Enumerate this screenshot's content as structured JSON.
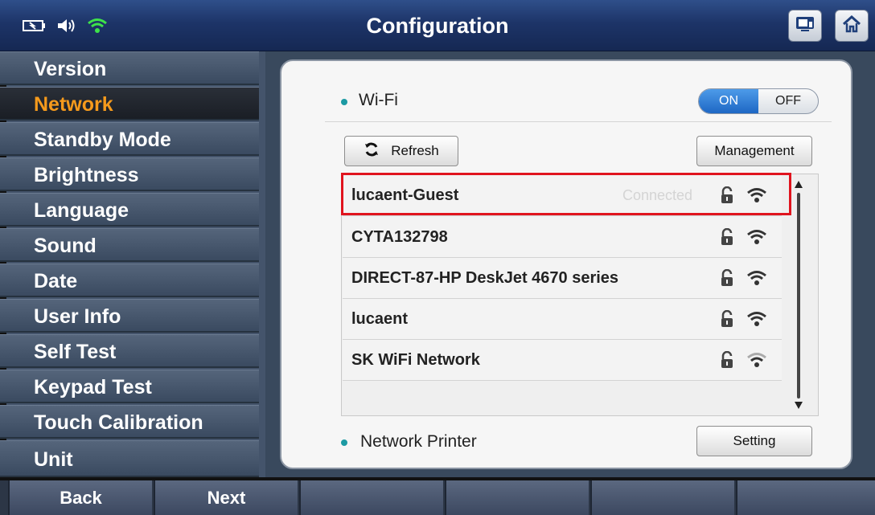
{
  "window": {
    "title": "Configuration"
  },
  "status_icons": [
    "battery-icon",
    "speaker-icon",
    "wifi-icon"
  ],
  "header_buttons": [
    "display-icon",
    "home-icon"
  ],
  "sidebar": {
    "items": [
      {
        "label": "Version"
      },
      {
        "label": "Network",
        "active": true
      },
      {
        "label": "Standby Mode"
      },
      {
        "label": "Brightness"
      },
      {
        "label": "Language"
      },
      {
        "label": "Sound"
      },
      {
        "label": "Date"
      },
      {
        "label": "User Info"
      },
      {
        "label": "Self Test"
      },
      {
        "label": "Keypad Test"
      },
      {
        "label": "Touch Calibration"
      },
      {
        "label": "Unit"
      }
    ]
  },
  "wifi": {
    "label": "Wi-Fi",
    "toggle": {
      "on": "ON",
      "off": "OFF",
      "state": "ON"
    },
    "refresh_label": "Refresh",
    "management_label": "Management",
    "networks": [
      {
        "name": "lucaent-Guest",
        "status": "Connected",
        "locked": true,
        "signal": 3
      },
      {
        "name": "CYTA132798",
        "status": "",
        "locked": true,
        "signal": 3
      },
      {
        "name": "DIRECT-87-HP DeskJet 4670 series",
        "status": "",
        "locked": true,
        "signal": 3
      },
      {
        "name": "lucaent",
        "status": "",
        "locked": true,
        "signal": 3
      },
      {
        "name": "SK WiFi Network",
        "status": "",
        "locked": true,
        "signal": 2
      }
    ]
  },
  "printer": {
    "label": "Network Printer",
    "setting_label": "Setting"
  },
  "footer": {
    "back": "Back",
    "next": "Next"
  },
  "colors": {
    "accent_orange": "#f59a1c",
    "toggle_blue": "#1e67c4",
    "highlight_red": "#e0141e",
    "bullet_teal": "#1c9aa3"
  }
}
